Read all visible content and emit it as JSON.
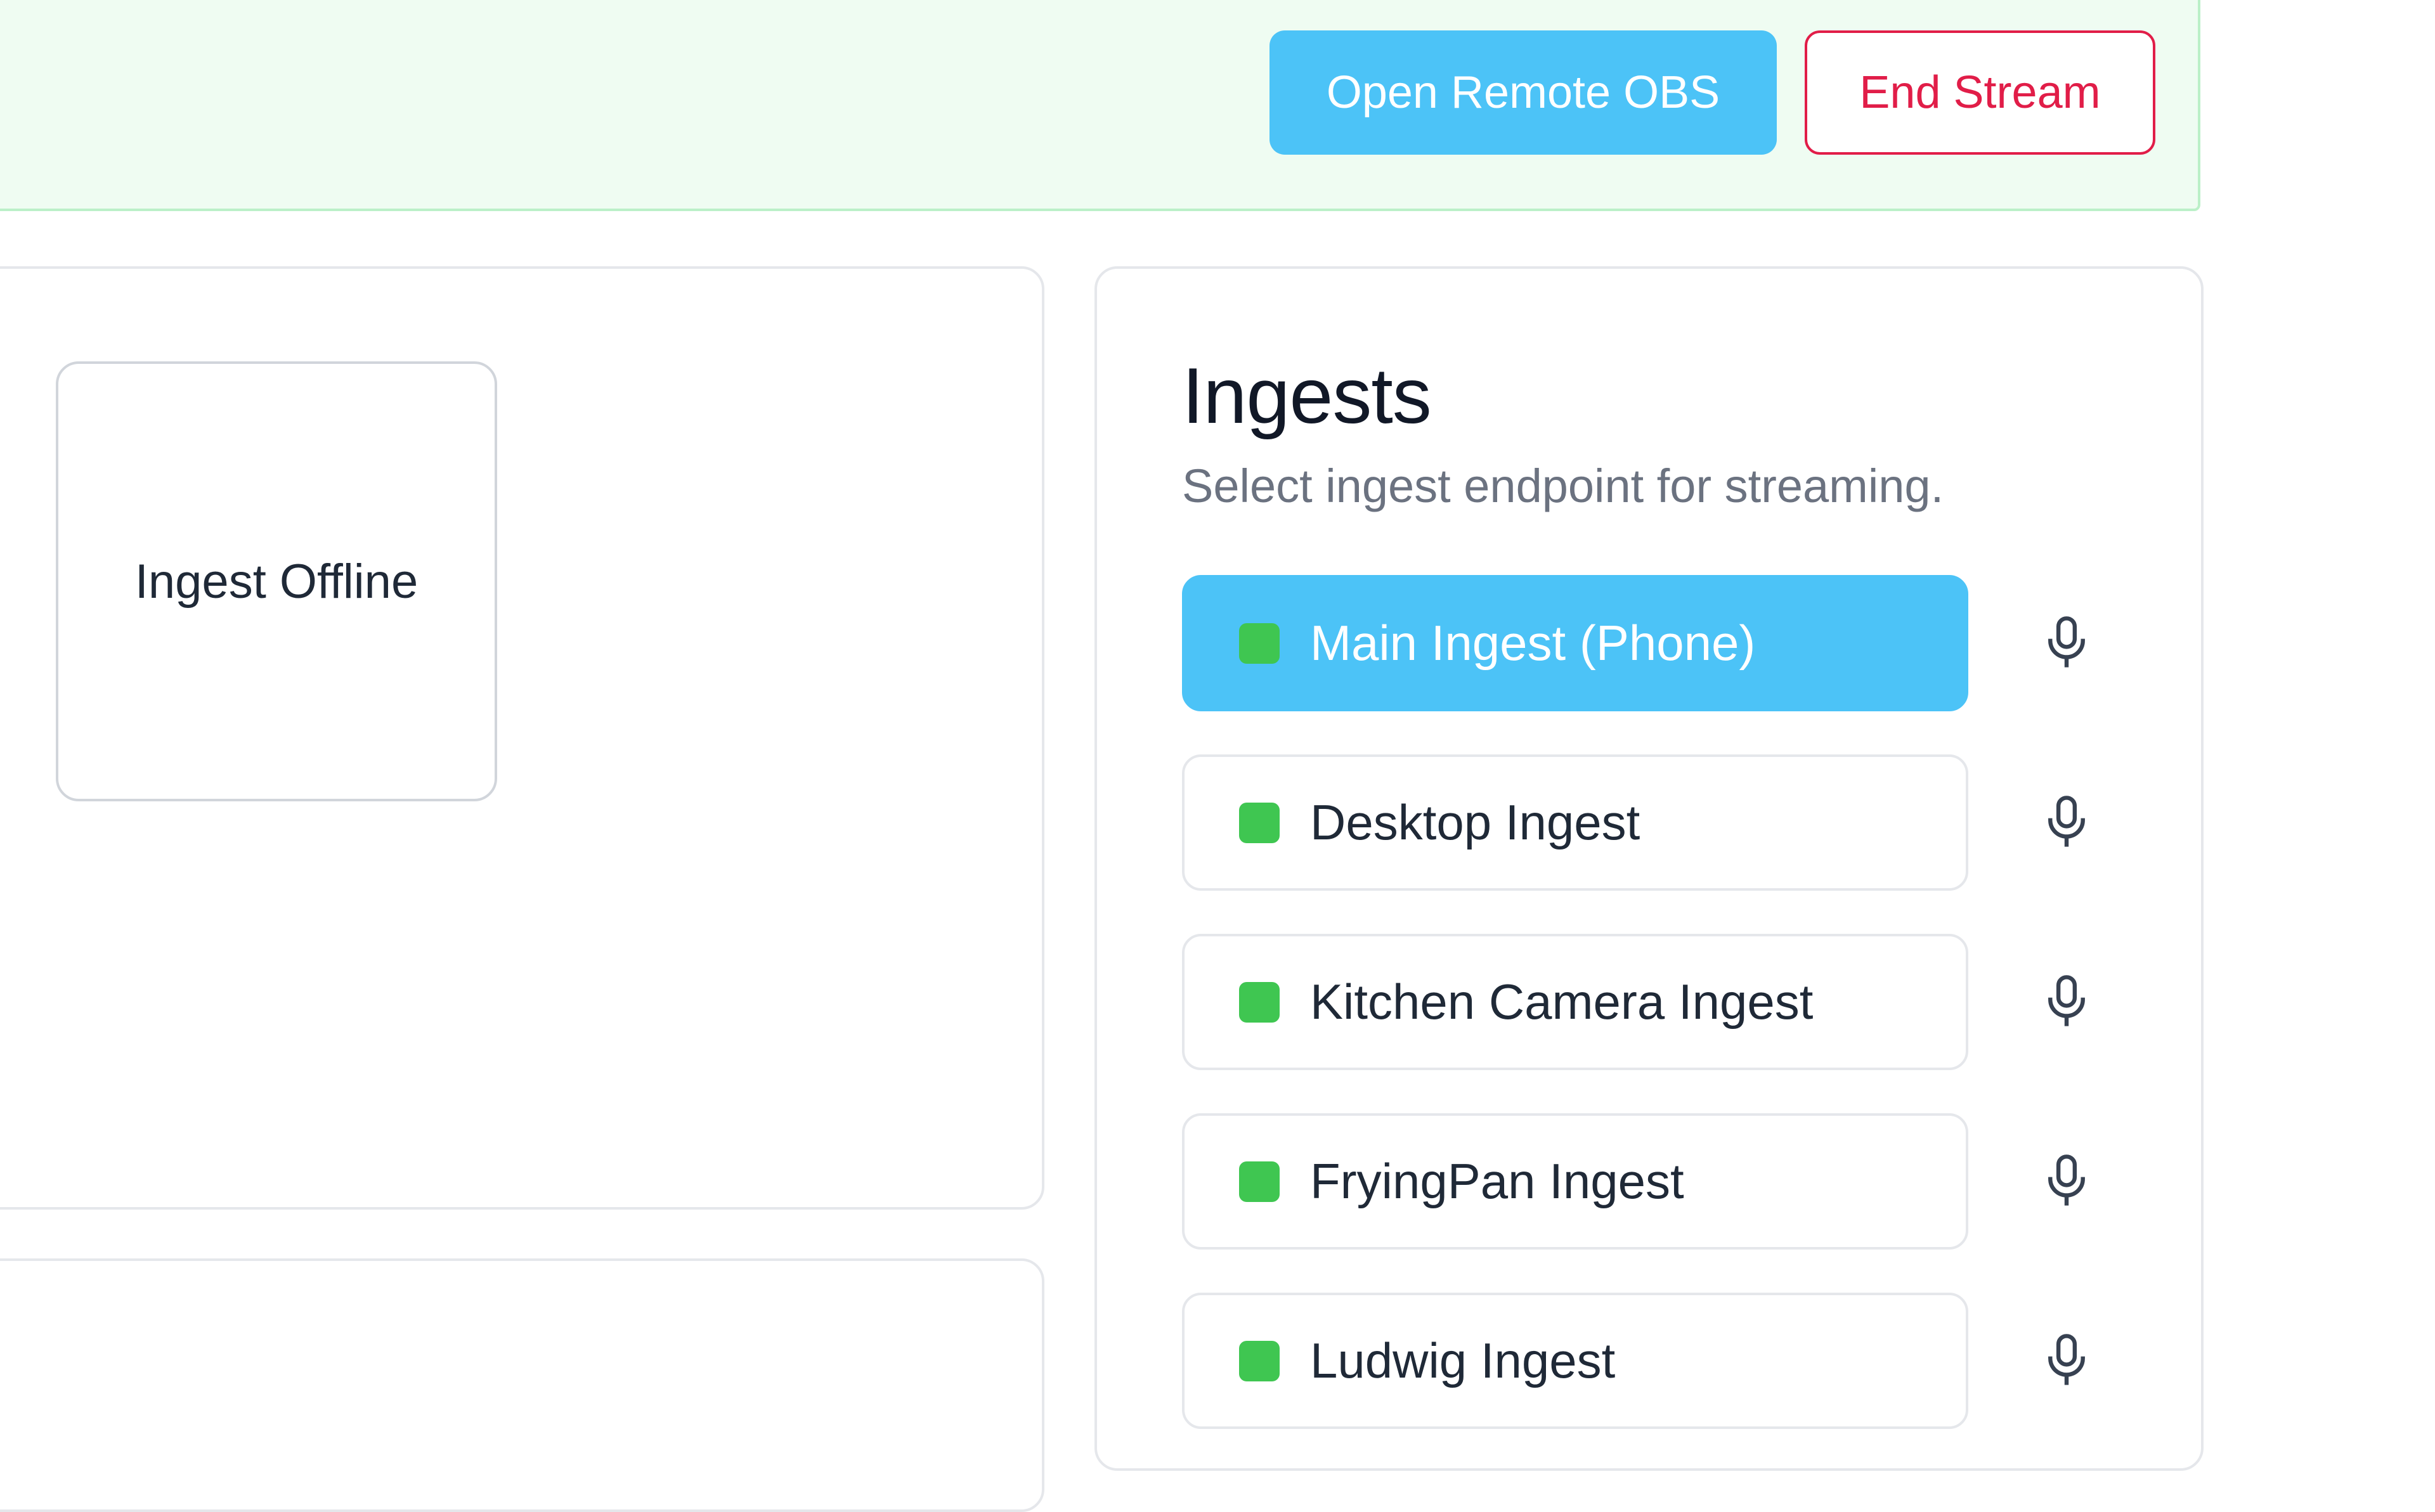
{
  "header": {
    "open_remote_obs_label": "Open Remote OBS",
    "end_stream_label": "End Stream"
  },
  "preview": {
    "status_text": "Ingest Offline"
  },
  "ingests": {
    "title": "Ingests",
    "subtitle": "Select ingest endpoint for streaming.",
    "items": [
      {
        "label": "Main Ingest (Phone)",
        "selected": true,
        "status": "online"
      },
      {
        "label": "Desktop Ingest",
        "selected": false,
        "status": "online"
      },
      {
        "label": "Kitchen Camera Ingest",
        "selected": false,
        "status": "online"
      },
      {
        "label": "FryingPan Ingest",
        "selected": false,
        "status": "online"
      },
      {
        "label": "Ludwig Ingest",
        "selected": false,
        "status": "online"
      }
    ],
    "item_icon": "microphone-icon",
    "status_icon": "status-square"
  },
  "colors": {
    "accent": "#4cc3f7",
    "danger": "#e11d48",
    "online": "#3fc651",
    "banner_bg": "#effcf2"
  }
}
